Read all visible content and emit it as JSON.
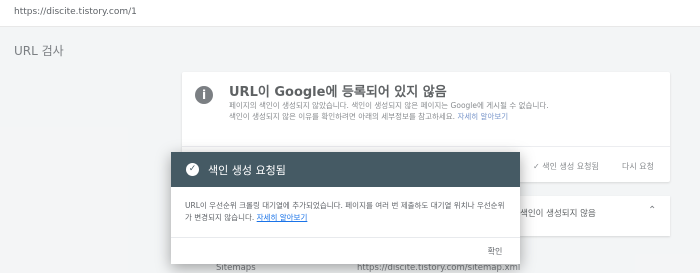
{
  "address_bar": {
    "url": "https://discite.tistory.com/1"
  },
  "page": {
    "title": "URL 검사"
  },
  "background_card": {
    "title": "URL이 Google에 등록되어 있지 않음",
    "description": "페이지의 색인이 생성되지 않았습니다. 색인이 생성되지 않은 페이지는 Google에 게시될 수 없습니다. 색인이 생성되지 않은 이유를 확인하려면 아래의 세부정보를 참고하세요.",
    "learn_more": "자세히 알아보기",
    "action_requested": "색인 생성 요청됨",
    "action_retest": "다시 요청"
  },
  "background_card2": {
    "text": "색인이 생성되지 않음"
  },
  "sitemaps": {
    "label": "Sitemaps",
    "url": "https://discite.tistory.com/sitemap.xml"
  },
  "dialog": {
    "title": "색인 생성 요청됨",
    "body": "URL이 우선순위 크롤링 대기열에 추가되었습니다. 페이지를 여러 번 제출하도 대기열 위치나 우선순위가 변경되지 않습니다.",
    "learn_more": "자세히 알아보기",
    "ok_label": "확인"
  },
  "colors": {
    "dialog_header": "#455a64",
    "link": "#1a73e8"
  }
}
